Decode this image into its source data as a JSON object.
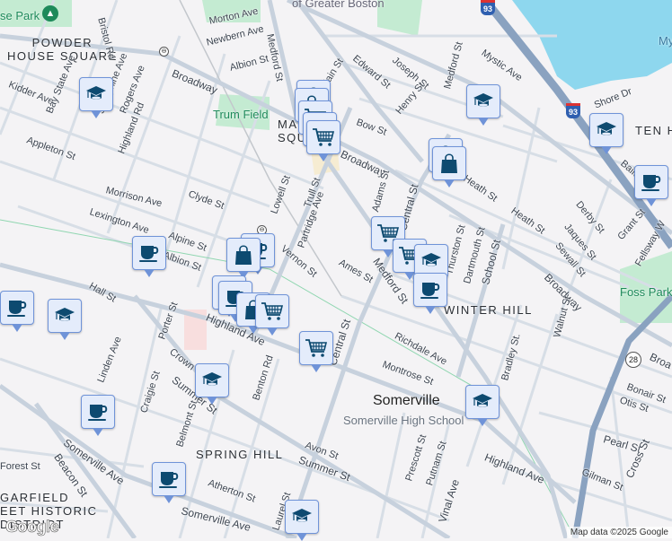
{
  "map": {
    "places": {
      "powder_house_park": "se Park",
      "powder_house_square": "POWDER\nHOUSE SQUARE",
      "trum_field": "Trum Field",
      "magoun_square": "MA\nSQU",
      "ten_hills": "TEN H",
      "winter_hill": "WINTER HILL",
      "foss_park": "Foss Park",
      "somerville": "Somerville",
      "somerville_high_school": "Somerville High School",
      "spring_hill": "SPRING HILL",
      "garfield": "GARFIELD\nEET HISTORIC\nDISTRICT",
      "greater_boston": "of Greater Boston",
      "mystic": "My"
    },
    "streets": [
      "Broadway",
      "Medford St",
      "Main St",
      "Mystic Ave",
      "Morton Ave",
      "Newbern Ave",
      "Albion St",
      "Bristol Rd",
      "Kidder Ave",
      "Bay State Ave",
      "Josephine Ave",
      "Rogers Ave",
      "Highland Rd",
      "Appleton St",
      "Morrison Ave",
      "Clyde St",
      "Lexington Ave",
      "Alpine St",
      "Albion St",
      "Lowell St",
      "Trull St",
      "Partridge Ave",
      "Vernon St",
      "Edward St",
      "Joseph St",
      "Henry St",
      "Bow St",
      "Broadway",
      "Heath St",
      "Heath St",
      "Derby St",
      "Jaques St",
      "Sewall St",
      "Grant St",
      "Adams St",
      "Central St",
      "Ames St",
      "Medford St",
      "Thurston St",
      "Dartmouth St",
      "School St",
      "Broadway",
      "Walnut St",
      "Bradley St.",
      "Richdale Ave",
      "Montrose St",
      "Highland Ave",
      "Central St",
      "Hall St",
      "Porter St",
      "Crown St",
      "Linden Ave",
      "Summer St",
      "Craigie St",
      "Belmont St",
      "Benton Rd",
      "Avon St",
      "Summer St",
      "Atherton St",
      "Somerville Ave",
      "Somerville Ave",
      "Beacon St",
      "Forest St",
      "Highland Ave",
      "Prescott St",
      "Putnam St",
      "Vinal Ave",
      "Pearl St",
      "Cross St",
      "Gilman St",
      "Bonair St",
      "Otis St",
      "Broa",
      "Laurel St",
      "Fellsway W",
      "Medford St",
      "Bailey Rd",
      "Shore Dr"
    ],
    "highway_shields": [
      "93",
      "93",
      "28"
    ],
    "attribution": "Map data ©2025 Google",
    "logo": "Google"
  },
  "markers": [
    {
      "type": "school",
      "icon": "graduation-cap-icon"
    },
    {
      "type": "school",
      "icon": "graduation-cap-icon"
    },
    {
      "type": "school",
      "icon": "graduation-cap-icon"
    },
    {
      "type": "cafe",
      "icon": "coffee-cup-icon"
    },
    {
      "type": "shop",
      "icon": "shopping-bag-icon"
    },
    {
      "type": "shop",
      "icon": "shopping-bag-icon"
    },
    {
      "type": "grocery",
      "icon": "shopping-cart-icon"
    },
    {
      "type": "grocery",
      "icon": "shopping-cart-icon"
    },
    {
      "type": "grocery",
      "icon": "shopping-cart-icon"
    },
    {
      "type": "grocery",
      "icon": "shopping-cart-icon"
    },
    {
      "type": "grocery",
      "icon": "shopping-cart-icon"
    },
    {
      "type": "school",
      "icon": "graduation-cap-icon"
    },
    {
      "type": "cafe",
      "icon": "coffee-cup-icon"
    },
    {
      "type": "cafe",
      "icon": "coffee-cup-icon"
    },
    {
      "type": "cafe",
      "icon": "coffee-cup-icon"
    },
    {
      "type": "shop",
      "icon": "shopping-bag-icon"
    },
    {
      "type": "cafe",
      "icon": "coffee-cup-icon"
    },
    {
      "type": "shop",
      "icon": "shopping-bag-icon"
    },
    {
      "type": "grocery",
      "icon": "shopping-cart-icon"
    },
    {
      "type": "grocery",
      "icon": "shopping-cart-icon"
    },
    {
      "type": "cafe",
      "icon": "coffee-cup-icon"
    },
    {
      "type": "school",
      "icon": "graduation-cap-icon"
    },
    {
      "type": "school",
      "icon": "graduation-cap-icon"
    },
    {
      "type": "cafe",
      "icon": "coffee-cup-icon"
    },
    {
      "type": "cafe",
      "icon": "coffee-cup-icon"
    },
    {
      "type": "school",
      "icon": "graduation-cap-icon"
    },
    {
      "type": "school",
      "icon": "graduation-cap-icon"
    }
  ],
  "colors": {
    "marker_bg": "#e4ecfb",
    "marker_border": "#6f93d8",
    "icon": "#0d4a70",
    "water": "#8ed7ee",
    "park": "#c4ebd2",
    "highway": "#8aa2c0"
  }
}
